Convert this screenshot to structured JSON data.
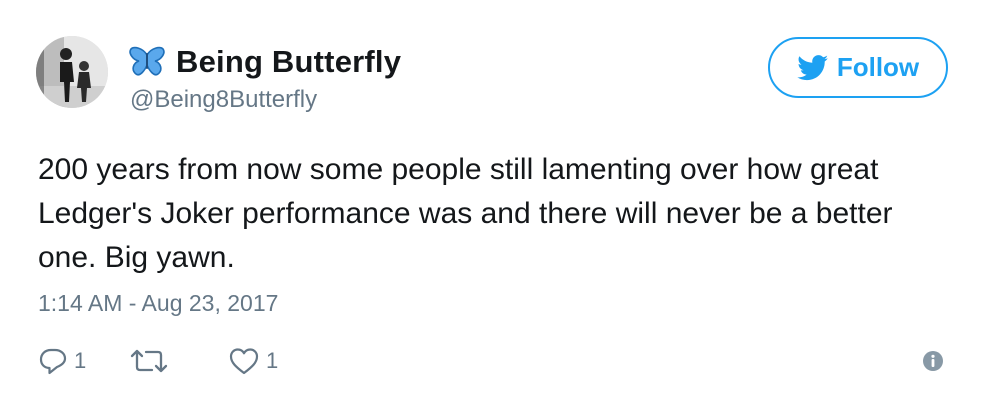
{
  "user": {
    "display_name": "Being Butterfly",
    "handle": "@Being8Butterfly"
  },
  "follow_button": {
    "label": "Follow"
  },
  "tweet": {
    "text": "200 years from now some people still lamenting over how great Ledger's Joker performance was and there will never be a better one. Big yawn.",
    "timestamp": "1:14 AM - Aug 23, 2017"
  },
  "actions": {
    "reply_count": "1",
    "like_count": "1"
  },
  "colors": {
    "accent": "#1da1f2",
    "secondary_text": "#657786",
    "primary_text": "#14171a",
    "butterfly": "#3b8fd9"
  },
  "icons": {
    "butterfly": "butterfly-icon",
    "bird": "twitter-bird-icon",
    "reply": "reply-icon",
    "retweet": "retweet-icon",
    "like": "heart-icon",
    "info": "info-icon"
  }
}
